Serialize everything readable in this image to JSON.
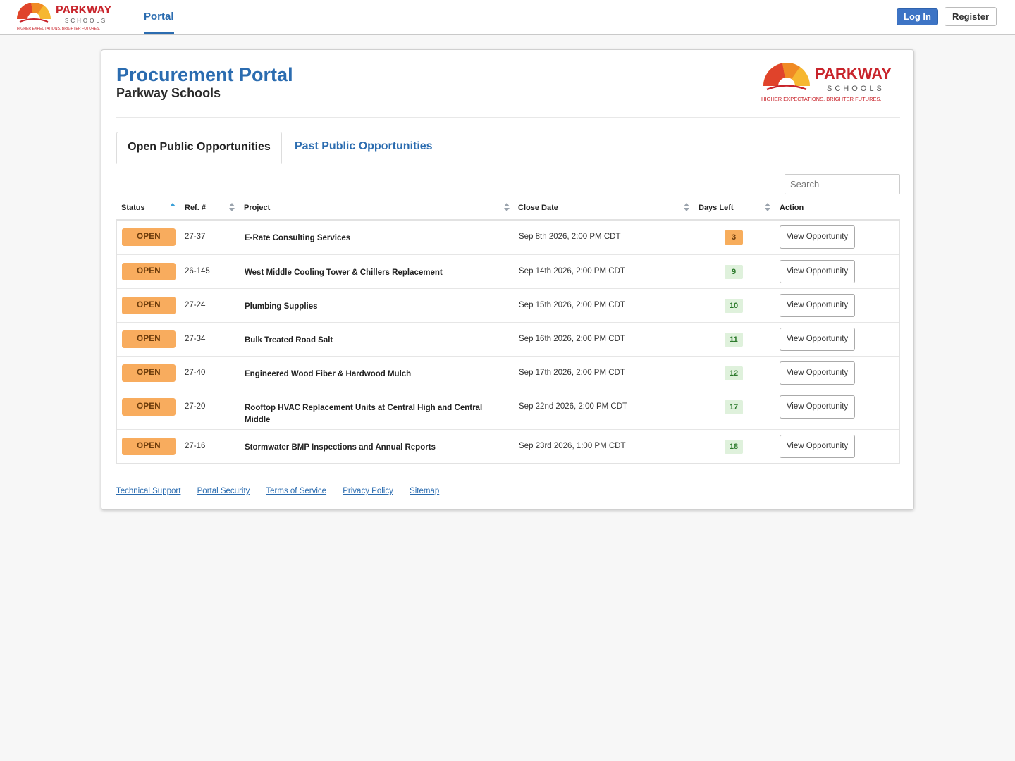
{
  "brand": {
    "name": "PARKWAY",
    "sub": "SCHOOLS",
    "tagline": "HIGHER EXPECTATIONS. BRIGHTER FUTURES.",
    "colors": {
      "red": "#c8242b",
      "orange": "#f08a24",
      "yellow": "#f6b731",
      "accent_blue": "#2b6cb0"
    }
  },
  "nav": {
    "portal": "Portal",
    "login": "Log In",
    "register": "Register"
  },
  "header": {
    "title": "Procurement Portal",
    "subtitle": "Parkway Schools"
  },
  "tabs": [
    {
      "label": "Open Public Opportunities",
      "active": true
    },
    {
      "label": "Past Public Opportunities",
      "active": false
    }
  ],
  "search": {
    "placeholder": "Search"
  },
  "table": {
    "columns": [
      "Status",
      "Ref. #",
      "Project",
      "Close Date",
      "Days Left",
      "Action"
    ],
    "rows": [
      {
        "status": "OPEN",
        "ref": "27-37",
        "project": "E-Rate Consulting Services",
        "close": "Sep 8th 2026, 2:00 PM CDT",
        "days": "3",
        "action": "View Opportunity"
      },
      {
        "status": "OPEN",
        "ref": "26-145",
        "project": "West Middle Cooling Tower & Chillers Replacement",
        "close": "Sep 14th 2026, 2:00 PM CDT",
        "days": "9",
        "action": "View Opportunity"
      },
      {
        "status": "OPEN",
        "ref": "27-24",
        "project": "Plumbing Supplies",
        "close": "Sep 15th 2026, 2:00 PM CDT",
        "days": "10",
        "action": "View Opportunity"
      },
      {
        "status": "OPEN",
        "ref": "27-34",
        "project": "Bulk Treated Road Salt",
        "close": "Sep 16th 2026, 2:00 PM CDT",
        "days": "11",
        "action": "View Opportunity"
      },
      {
        "status": "OPEN",
        "ref": "27-40",
        "project": "Engineered Wood Fiber & Hardwood Mulch",
        "close": "Sep 17th 2026, 2:00 PM CDT",
        "days": "12",
        "action": "View Opportunity"
      },
      {
        "status": "OPEN",
        "ref": "27-20",
        "project": "Rooftop HVAC Replacement Units at Central High and Central Middle",
        "close": "Sep 22nd 2026, 2:00 PM CDT",
        "days": "17",
        "action": "View Opportunity"
      },
      {
        "status": "OPEN",
        "ref": "27-16",
        "project": "Stormwater BMP Inspections and Annual Reports",
        "close": "Sep 23rd 2026, 1:00 PM CDT",
        "days": "18",
        "action": "View Opportunity"
      }
    ]
  },
  "footer": {
    "links": [
      "Technical Support",
      "Portal Security",
      "Terms of Service",
      "Privacy Policy",
      "Sitemap"
    ]
  }
}
